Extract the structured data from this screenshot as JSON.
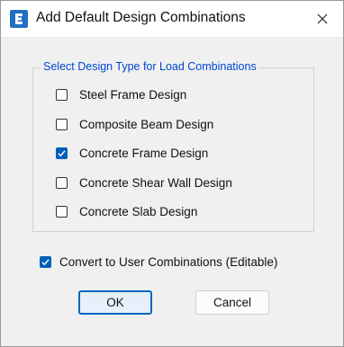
{
  "window": {
    "title": "Add Default Design Combinations",
    "icon_name": "etabs-app-icon",
    "close_icon": "close-icon"
  },
  "group": {
    "legend": "Select Design Type for Load Combinations",
    "items": [
      {
        "label": "Steel Frame Design",
        "checked": false
      },
      {
        "label": "Composite Beam Design",
        "checked": false
      },
      {
        "label": "Concrete Frame Design",
        "checked": true
      },
      {
        "label": "Concrete Shear Wall Design",
        "checked": false
      },
      {
        "label": "Concrete Slab Design",
        "checked": false
      }
    ]
  },
  "convert": {
    "label": "Convert to User Combinations (Editable)",
    "checked": true
  },
  "buttons": {
    "ok_label": "OK",
    "cancel_label": "Cancel"
  },
  "colors": {
    "accent": "#005fb8",
    "legend": "#0046d5",
    "app_icon": "#1f6fc5"
  }
}
